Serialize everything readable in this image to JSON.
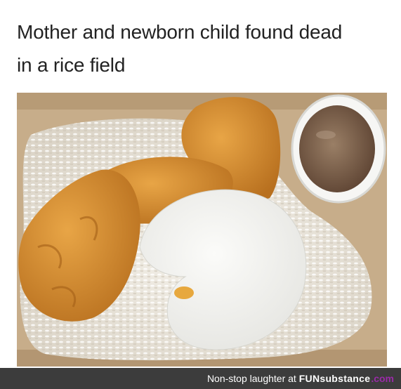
{
  "caption": {
    "line1": "Mother and newborn child found dead",
    "line2": "in a rice field"
  },
  "footer": {
    "text": "Non-stop laughter at",
    "brand_left": "FUNsubstance",
    "brand_right": ".com"
  },
  "colors": {
    "footer_bg": "#3c3c3c",
    "accent": "#9a2aa8"
  }
}
